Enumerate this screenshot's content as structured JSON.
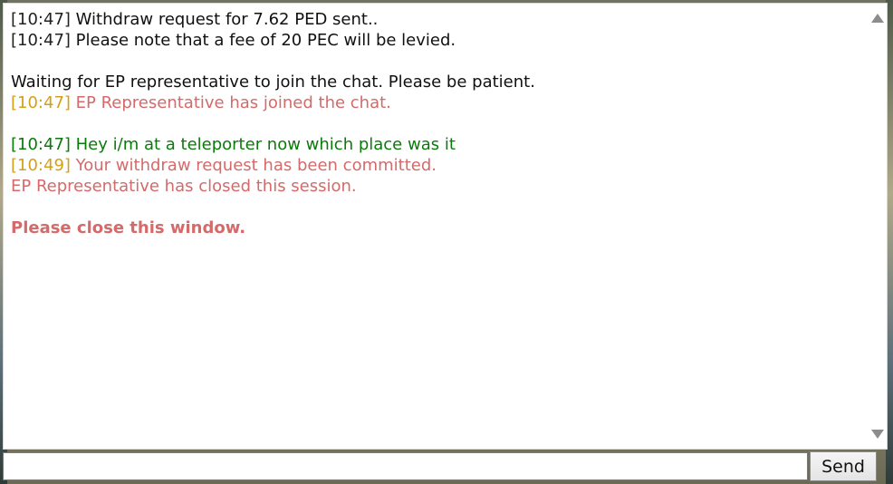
{
  "chat": {
    "lines": [
      {
        "timestamp": "[10:47]",
        "text": " Withdraw request for 7.62 PED sent.."
      },
      {
        "timestamp": "[10:47]",
        "text": " Please note that a fee of 20 PEC will be levied."
      },
      {
        "text": "Waiting for EP representative to join the chat. Please be patient."
      },
      {
        "timestamp": "[10:47]",
        "text": " EP Representative has joined the chat."
      },
      {
        "timestamp": "[10:47]",
        "text": " Hey i/m at a teleporter now which place was it"
      },
      {
        "timestamp": "[10:49]",
        "text": " Your withdraw request has been committed."
      },
      {
        "text": "EP Representative has closed this session."
      },
      {
        "text": "Please close this window."
      }
    ]
  },
  "input": {
    "value": "",
    "placeholder": ""
  },
  "send_button": {
    "label": "Send"
  },
  "icons": {
    "scroll_up": "triangle-up",
    "scroll_down": "triangle-down"
  },
  "colors": {
    "system_text": "#111111",
    "representative_timestamp": "#d4a017",
    "representative_text": "#d46a6a",
    "user_text": "#0b7a0b"
  }
}
